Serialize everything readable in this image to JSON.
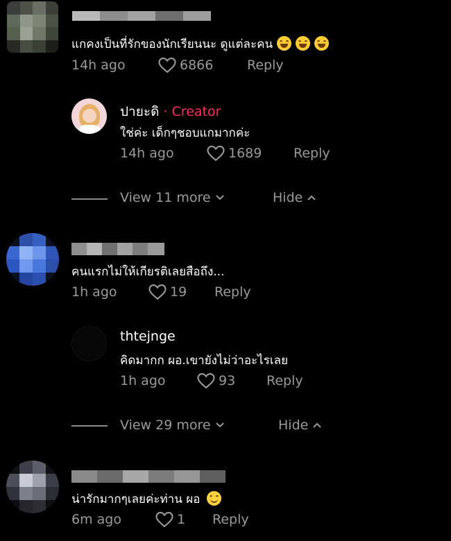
{
  "comments": [
    {
      "text": "แกคงเป็นที่รักของนักเรียนนะ ดูแต่ละคน",
      "time": "14h ago",
      "likes": "6866",
      "reply": "Reply",
      "emojis": [
        "grinning-sweat-emoji",
        "grinning-sweat-emoji",
        "grinning-sweat-emoji"
      ],
      "reply_item": {
        "name": "ปายะดิ",
        "badge": "· Creator",
        "text": "ใช่ค่ะ เด็กๆชอบแกมากค่ะ",
        "time": "14h ago",
        "likes": "1689",
        "reply": "Reply"
      },
      "view_more": "View 11 more",
      "hide": "Hide"
    },
    {
      "text": "คนแรกไม่ให้เกียรติเลยสือถึง...",
      "time": "1h ago",
      "likes": "19",
      "reply": "Reply",
      "reply_item": {
        "name": "thtejnge",
        "text": "คิดมากก ผอ.เขายังไม่ว่าอะไรเลย",
        "time": "1h ago",
        "likes": "93",
        "reply": "Reply"
      },
      "view_more": "View 29 more",
      "hide": "Hide"
    },
    {
      "text": "น่ารักมากๆเลยค่ะท่าน ผอ",
      "time": "6m ago",
      "likes": "1",
      "reply": "Reply",
      "emojis": [
        "smiling-emoji"
      ]
    }
  ],
  "icons": {
    "like": "heart-outline-icon",
    "expand": "chevron-down-icon",
    "collapse": "chevron-up-icon"
  },
  "colors": {
    "background": "#000000",
    "text": "#ffffff",
    "muted": "#9a9a9a",
    "creator_badge": "#fe2c55"
  }
}
